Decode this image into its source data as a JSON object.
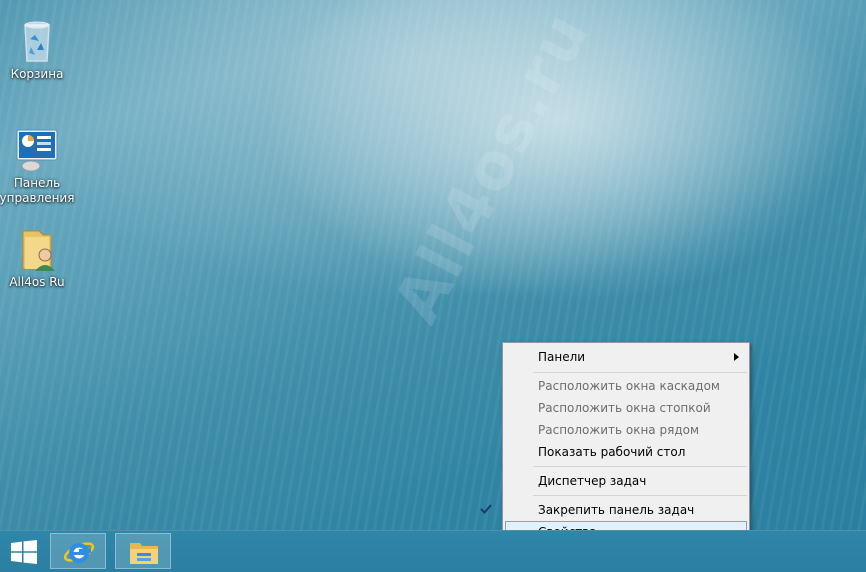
{
  "desktop": {
    "watermark": "All4os.ru",
    "icons": [
      {
        "label": "Корзина",
        "icon": "recycle-bin-icon"
      },
      {
        "label": "Панель\nуправления",
        "icon": "control-panel-icon"
      },
      {
        "label": "All4os Ru",
        "icon": "user-folder-icon"
      }
    ]
  },
  "taskbar": {
    "start": "windows-logo-icon",
    "pinned": [
      {
        "icon": "internet-explorer-icon"
      },
      {
        "icon": "file-explorer-icon"
      }
    ]
  },
  "context_menu": {
    "items": [
      {
        "label": "Панели",
        "submenu": true,
        "enabled": true
      },
      {
        "label": "Расположить окна каскадом",
        "enabled": false
      },
      {
        "label": "Расположить окна стопкой",
        "enabled": false
      },
      {
        "label": "Расположить окна рядом",
        "enabled": false
      },
      {
        "label": "Показать рабочий стол",
        "enabled": true
      },
      {
        "label": "Диспетчер задач",
        "enabled": true
      },
      {
        "label": "Закрепить панель задач",
        "enabled": true,
        "checked": true
      },
      {
        "label": "Свойства",
        "enabled": true,
        "highlighted": true
      }
    ]
  },
  "colors": {
    "taskbar": "#2b7fa2",
    "menu_bg": "#f0f0f0",
    "menu_highlight": "#e5f0fb",
    "highlight_border": "#7aa5d8"
  }
}
